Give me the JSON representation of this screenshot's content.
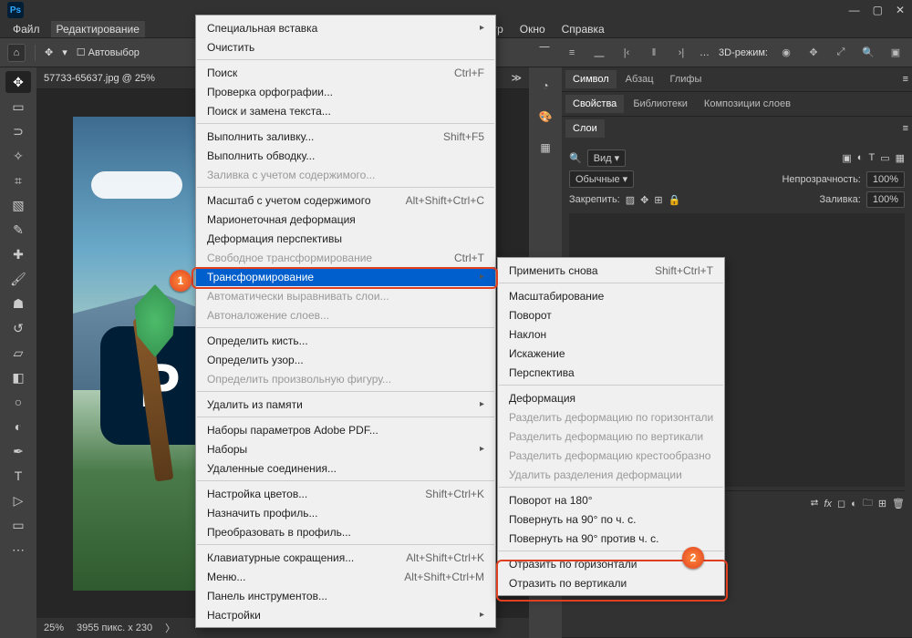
{
  "app_label": "Ps",
  "menubar": {
    "file": "Файл",
    "edit": "Редактирование",
    "view": "Просмотр",
    "window": "Окно",
    "help": "Справка"
  },
  "options": {
    "auto_select": "Автовыбор",
    "mode_3d": "3D-режим:",
    "aligns": []
  },
  "doc": {
    "tab": "57733-65637.jpg @ 25%",
    "p_glyph": "P"
  },
  "status": {
    "zoom": "25%",
    "dims": "3955 пикс. х 230"
  },
  "right": {
    "p_symbol": {
      "tabs": [
        "Символ",
        "Абзац",
        "Глифы"
      ],
      "active": 0
    },
    "p_props": {
      "tabs": [
        "Свойства",
        "Библиотеки",
        "Композиции слоев"
      ],
      "active": 0
    },
    "p_layers": {
      "tab": "Слои",
      "filter_label": "Вид",
      "blend_label": "Обычные",
      "opacity_label": "Непрозрачность:",
      "opacity_val": "100%",
      "lock_label": "Закрепить:",
      "fill_label": "Заливка:",
      "fill_val": "100%"
    }
  },
  "edit_menu": {
    "items": [
      {
        "label": "Специальная вставка",
        "sub": true
      },
      {
        "label": "Очистить"
      },
      {
        "sep": true
      },
      {
        "label": "Поиск",
        "sc": "Ctrl+F"
      },
      {
        "label": "Проверка орфографии..."
      },
      {
        "label": "Поиск и замена текста..."
      },
      {
        "sep": true
      },
      {
        "label": "Выполнить заливку...",
        "sc": "Shift+F5"
      },
      {
        "label": "Выполнить обводку..."
      },
      {
        "label": "Заливка с учетом содержимого...",
        "disabled": true
      },
      {
        "sep": true
      },
      {
        "label": "Масштаб с учетом содержимого",
        "sc": "Alt+Shift+Ctrl+C"
      },
      {
        "label": "Марионеточная деформация"
      },
      {
        "label": "Деформация перспективы"
      },
      {
        "label": "Свободное трансформирование",
        "sc": "Ctrl+T",
        "disabled": true
      },
      {
        "label": "Трансформирование",
        "sub": true,
        "selected": true
      },
      {
        "label": "Автоматически выравнивать слои...",
        "disabled": true
      },
      {
        "label": "Автоналожение слоев...",
        "disabled": true
      },
      {
        "sep": true
      },
      {
        "label": "Определить кисть..."
      },
      {
        "label": "Определить узор..."
      },
      {
        "label": "Определить произвольную фигуру...",
        "disabled": true
      },
      {
        "sep": true
      },
      {
        "label": "Удалить из памяти",
        "sub": true
      },
      {
        "sep": true
      },
      {
        "label": "Наборы параметров Adobe PDF..."
      },
      {
        "label": "Наборы",
        "sub": true
      },
      {
        "label": "Удаленные соединения..."
      },
      {
        "sep": true
      },
      {
        "label": "Настройка цветов...",
        "sc": "Shift+Ctrl+K"
      },
      {
        "label": "Назначить профиль..."
      },
      {
        "label": "Преобразовать в профиль..."
      },
      {
        "sep": true
      },
      {
        "label": "Клавиатурные сокращения...",
        "sc": "Alt+Shift+Ctrl+K"
      },
      {
        "label": "Меню...",
        "sc": "Alt+Shift+Ctrl+M"
      },
      {
        "label": "Панель инструментов..."
      },
      {
        "label": "Настройки",
        "sub": true
      }
    ]
  },
  "transform_submenu": {
    "items": [
      {
        "label": "Применить снова",
        "sc": "Shift+Ctrl+T"
      },
      {
        "sep": true
      },
      {
        "label": "Масштабирование"
      },
      {
        "label": "Поворот"
      },
      {
        "label": "Наклон"
      },
      {
        "label": "Искажение"
      },
      {
        "label": "Перспектива"
      },
      {
        "sep": true
      },
      {
        "label": "Деформация"
      },
      {
        "label": "Разделить деформацию по горизонтали",
        "disabled": true
      },
      {
        "label": "Разделить деформацию по вертикали",
        "disabled": true
      },
      {
        "label": "Разделить деформацию крестообразно",
        "disabled": true
      },
      {
        "label": "Удалить разделения деформации",
        "disabled": true
      },
      {
        "sep": true
      },
      {
        "label": "Поворот на 180°"
      },
      {
        "label": "Повернуть на 90° по ч. с."
      },
      {
        "label": "Повернуть на 90° против ч. с."
      },
      {
        "sep": true
      },
      {
        "label": "Отразить по горизонтали"
      },
      {
        "label": "Отразить по вертикали"
      }
    ]
  },
  "callouts": {
    "c1": "1",
    "c2": "2"
  }
}
